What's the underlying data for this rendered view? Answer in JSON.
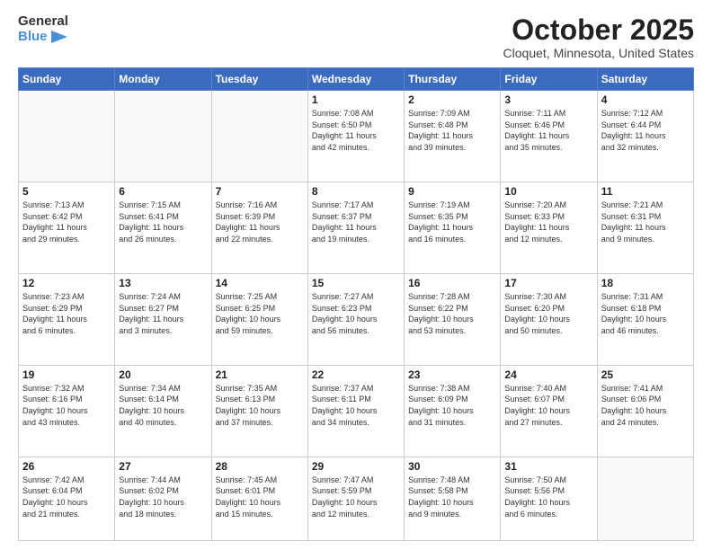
{
  "header": {
    "logo": {
      "general": "General",
      "blue": "Blue"
    },
    "title": "October 2025",
    "location": "Cloquet, Minnesota, United States"
  },
  "weekdays": [
    "Sunday",
    "Monday",
    "Tuesday",
    "Wednesday",
    "Thursday",
    "Friday",
    "Saturday"
  ],
  "weeks": [
    [
      {
        "day": "",
        "info": ""
      },
      {
        "day": "",
        "info": ""
      },
      {
        "day": "",
        "info": ""
      },
      {
        "day": "1",
        "info": "Sunrise: 7:08 AM\nSunset: 6:50 PM\nDaylight: 11 hours\nand 42 minutes."
      },
      {
        "day": "2",
        "info": "Sunrise: 7:09 AM\nSunset: 6:48 PM\nDaylight: 11 hours\nand 39 minutes."
      },
      {
        "day": "3",
        "info": "Sunrise: 7:11 AM\nSunset: 6:46 PM\nDaylight: 11 hours\nand 35 minutes."
      },
      {
        "day": "4",
        "info": "Sunrise: 7:12 AM\nSunset: 6:44 PM\nDaylight: 11 hours\nand 32 minutes."
      }
    ],
    [
      {
        "day": "5",
        "info": "Sunrise: 7:13 AM\nSunset: 6:42 PM\nDaylight: 11 hours\nand 29 minutes."
      },
      {
        "day": "6",
        "info": "Sunrise: 7:15 AM\nSunset: 6:41 PM\nDaylight: 11 hours\nand 26 minutes."
      },
      {
        "day": "7",
        "info": "Sunrise: 7:16 AM\nSunset: 6:39 PM\nDaylight: 11 hours\nand 22 minutes."
      },
      {
        "day": "8",
        "info": "Sunrise: 7:17 AM\nSunset: 6:37 PM\nDaylight: 11 hours\nand 19 minutes."
      },
      {
        "day": "9",
        "info": "Sunrise: 7:19 AM\nSunset: 6:35 PM\nDaylight: 11 hours\nand 16 minutes."
      },
      {
        "day": "10",
        "info": "Sunrise: 7:20 AM\nSunset: 6:33 PM\nDaylight: 11 hours\nand 12 minutes."
      },
      {
        "day": "11",
        "info": "Sunrise: 7:21 AM\nSunset: 6:31 PM\nDaylight: 11 hours\nand 9 minutes."
      }
    ],
    [
      {
        "day": "12",
        "info": "Sunrise: 7:23 AM\nSunset: 6:29 PM\nDaylight: 11 hours\nand 6 minutes."
      },
      {
        "day": "13",
        "info": "Sunrise: 7:24 AM\nSunset: 6:27 PM\nDaylight: 11 hours\nand 3 minutes."
      },
      {
        "day": "14",
        "info": "Sunrise: 7:25 AM\nSunset: 6:25 PM\nDaylight: 10 hours\nand 59 minutes."
      },
      {
        "day": "15",
        "info": "Sunrise: 7:27 AM\nSunset: 6:23 PM\nDaylight: 10 hours\nand 56 minutes."
      },
      {
        "day": "16",
        "info": "Sunrise: 7:28 AM\nSunset: 6:22 PM\nDaylight: 10 hours\nand 53 minutes."
      },
      {
        "day": "17",
        "info": "Sunrise: 7:30 AM\nSunset: 6:20 PM\nDaylight: 10 hours\nand 50 minutes."
      },
      {
        "day": "18",
        "info": "Sunrise: 7:31 AM\nSunset: 6:18 PM\nDaylight: 10 hours\nand 46 minutes."
      }
    ],
    [
      {
        "day": "19",
        "info": "Sunrise: 7:32 AM\nSunset: 6:16 PM\nDaylight: 10 hours\nand 43 minutes."
      },
      {
        "day": "20",
        "info": "Sunrise: 7:34 AM\nSunset: 6:14 PM\nDaylight: 10 hours\nand 40 minutes."
      },
      {
        "day": "21",
        "info": "Sunrise: 7:35 AM\nSunset: 6:13 PM\nDaylight: 10 hours\nand 37 minutes."
      },
      {
        "day": "22",
        "info": "Sunrise: 7:37 AM\nSunset: 6:11 PM\nDaylight: 10 hours\nand 34 minutes."
      },
      {
        "day": "23",
        "info": "Sunrise: 7:38 AM\nSunset: 6:09 PM\nDaylight: 10 hours\nand 31 minutes."
      },
      {
        "day": "24",
        "info": "Sunrise: 7:40 AM\nSunset: 6:07 PM\nDaylight: 10 hours\nand 27 minutes."
      },
      {
        "day": "25",
        "info": "Sunrise: 7:41 AM\nSunset: 6:06 PM\nDaylight: 10 hours\nand 24 minutes."
      }
    ],
    [
      {
        "day": "26",
        "info": "Sunrise: 7:42 AM\nSunset: 6:04 PM\nDaylight: 10 hours\nand 21 minutes."
      },
      {
        "day": "27",
        "info": "Sunrise: 7:44 AM\nSunset: 6:02 PM\nDaylight: 10 hours\nand 18 minutes."
      },
      {
        "day": "28",
        "info": "Sunrise: 7:45 AM\nSunset: 6:01 PM\nDaylight: 10 hours\nand 15 minutes."
      },
      {
        "day": "29",
        "info": "Sunrise: 7:47 AM\nSunset: 5:59 PM\nDaylight: 10 hours\nand 12 minutes."
      },
      {
        "day": "30",
        "info": "Sunrise: 7:48 AM\nSunset: 5:58 PM\nDaylight: 10 hours\nand 9 minutes."
      },
      {
        "day": "31",
        "info": "Sunrise: 7:50 AM\nSunset: 5:56 PM\nDaylight: 10 hours\nand 6 minutes."
      },
      {
        "day": "",
        "info": ""
      }
    ]
  ]
}
